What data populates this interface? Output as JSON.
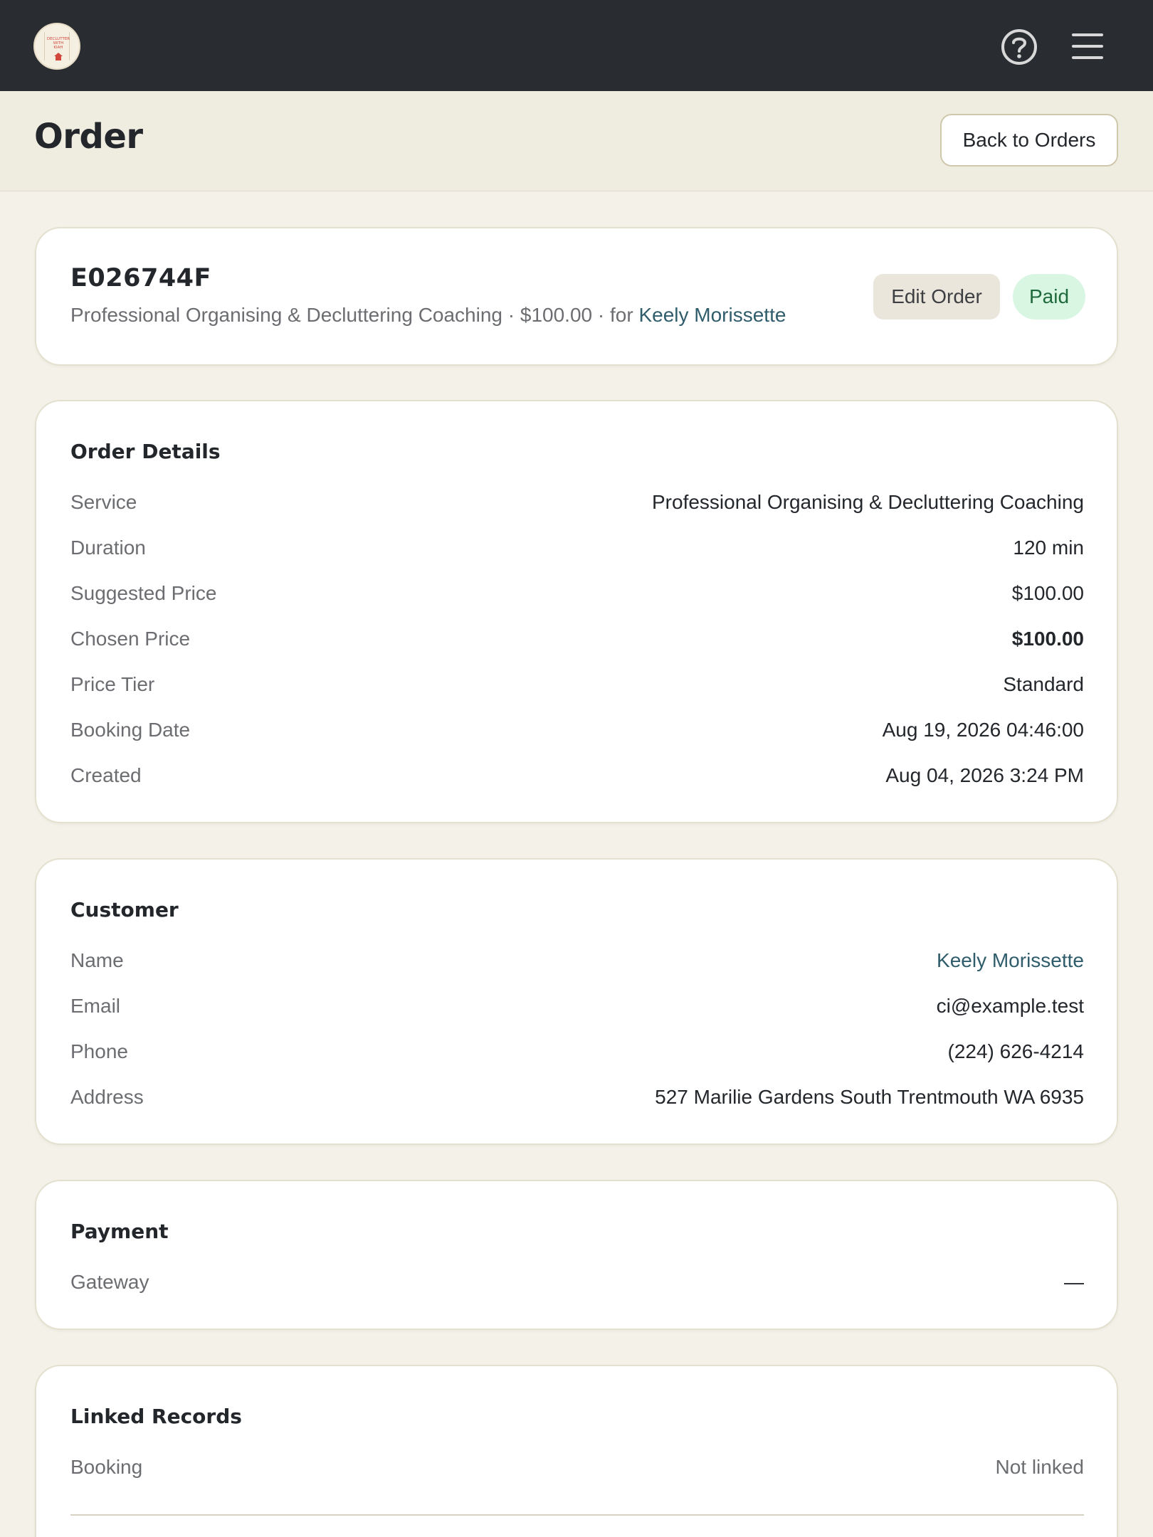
{
  "header": {
    "logo_text": "DECLUTTER\nWITH\nKIAH",
    "title": "Order",
    "back_label": "Back to Orders"
  },
  "summary": {
    "order_id": "E026744F",
    "service": "Professional Organising & Decluttering Coaching",
    "sep1": " · ",
    "price": "$100.00",
    "sep2": " · for ",
    "customer": "Keely Morissette",
    "edit_label": "Edit Order",
    "status": "Paid"
  },
  "order_details": {
    "title": "Order Details",
    "rows": [
      {
        "label": "Service",
        "value": "Professional Organising & Decluttering Coaching"
      },
      {
        "label": "Duration",
        "value": "120 min"
      },
      {
        "label": "Suggested Price",
        "value": "$100.00"
      },
      {
        "label": "Chosen Price",
        "value": "$100.00"
      },
      {
        "label": "Price Tier",
        "value": "Standard"
      },
      {
        "label": "Booking Date",
        "value": "Aug 19, 2026 04:46:00"
      },
      {
        "label": "Created",
        "value": "Aug 04, 2026 3:24 PM"
      }
    ]
  },
  "customer": {
    "title": "Customer",
    "rows": [
      {
        "label": "Name",
        "value": "Keely Morissette"
      },
      {
        "label": "Email",
        "value": "ci@example.test"
      },
      {
        "label": "Phone",
        "value": "(224) 626-4214"
      },
      {
        "label": "Address",
        "value": "527 Marilie Gardens South Trentmouth WA 6935"
      }
    ]
  },
  "payment": {
    "title": "Payment",
    "rows": [
      {
        "label": "Gateway",
        "value": "—"
      }
    ]
  },
  "linked_records": {
    "title": "Linked Records",
    "rows": [
      {
        "label": "Booking",
        "value": "Not linked"
      }
    ]
  }
}
